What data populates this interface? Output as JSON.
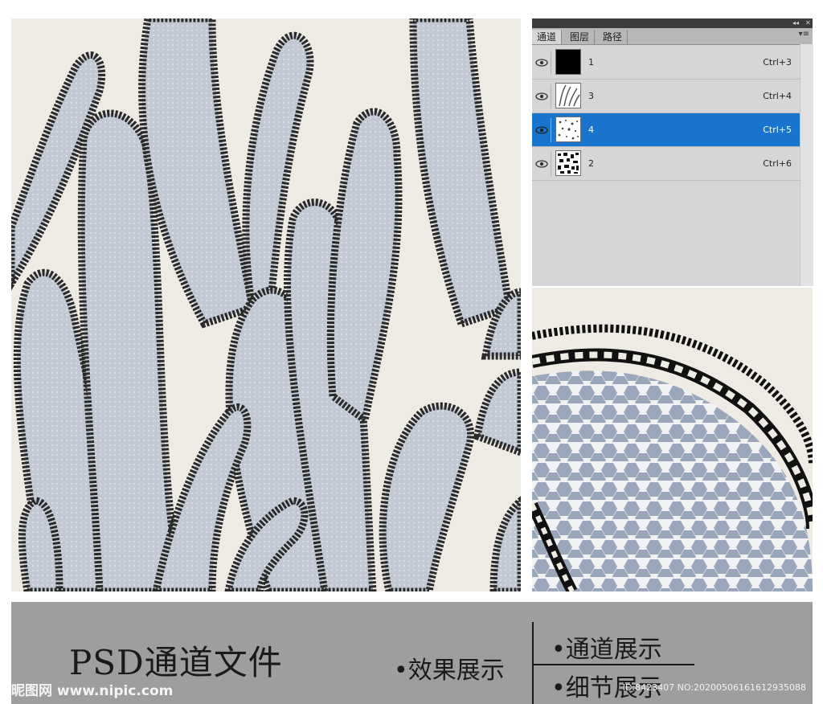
{
  "colors": {
    "background": "#eeebe4",
    "petal_fill": "#c2c8d4",
    "outline": "#2a2a2a",
    "selection": "#1874cd",
    "footer_bg": "#9e9e9e"
  },
  "panel": {
    "tabs": [
      {
        "label": "通道",
        "active": true
      },
      {
        "label": "图层",
        "active": false
      },
      {
        "label": "路径",
        "active": false
      }
    ],
    "channels": [
      {
        "name": "1",
        "shortcut": "Ctrl+3",
        "thumbnail": "solid-black",
        "selected": false
      },
      {
        "name": "3",
        "shortcut": "Ctrl+4",
        "thumbnail": "pattern-lines",
        "selected": false
      },
      {
        "name": "4",
        "shortcut": "Ctrl+5",
        "thumbnail": "pattern-speckle",
        "selected": true
      },
      {
        "name": "2",
        "shortcut": "Ctrl+6",
        "thumbnail": "pattern-dense",
        "selected": false
      }
    ]
  },
  "footer": {
    "title": "PSD通道文件",
    "effect_label": "•效果展示",
    "channel_label": "•通道展示",
    "detail_label": "•细节展示",
    "watermark_logo": "昵图网 www.nipic.com",
    "watermark_id": "ID:8423407 NO:20200506161612935088"
  }
}
